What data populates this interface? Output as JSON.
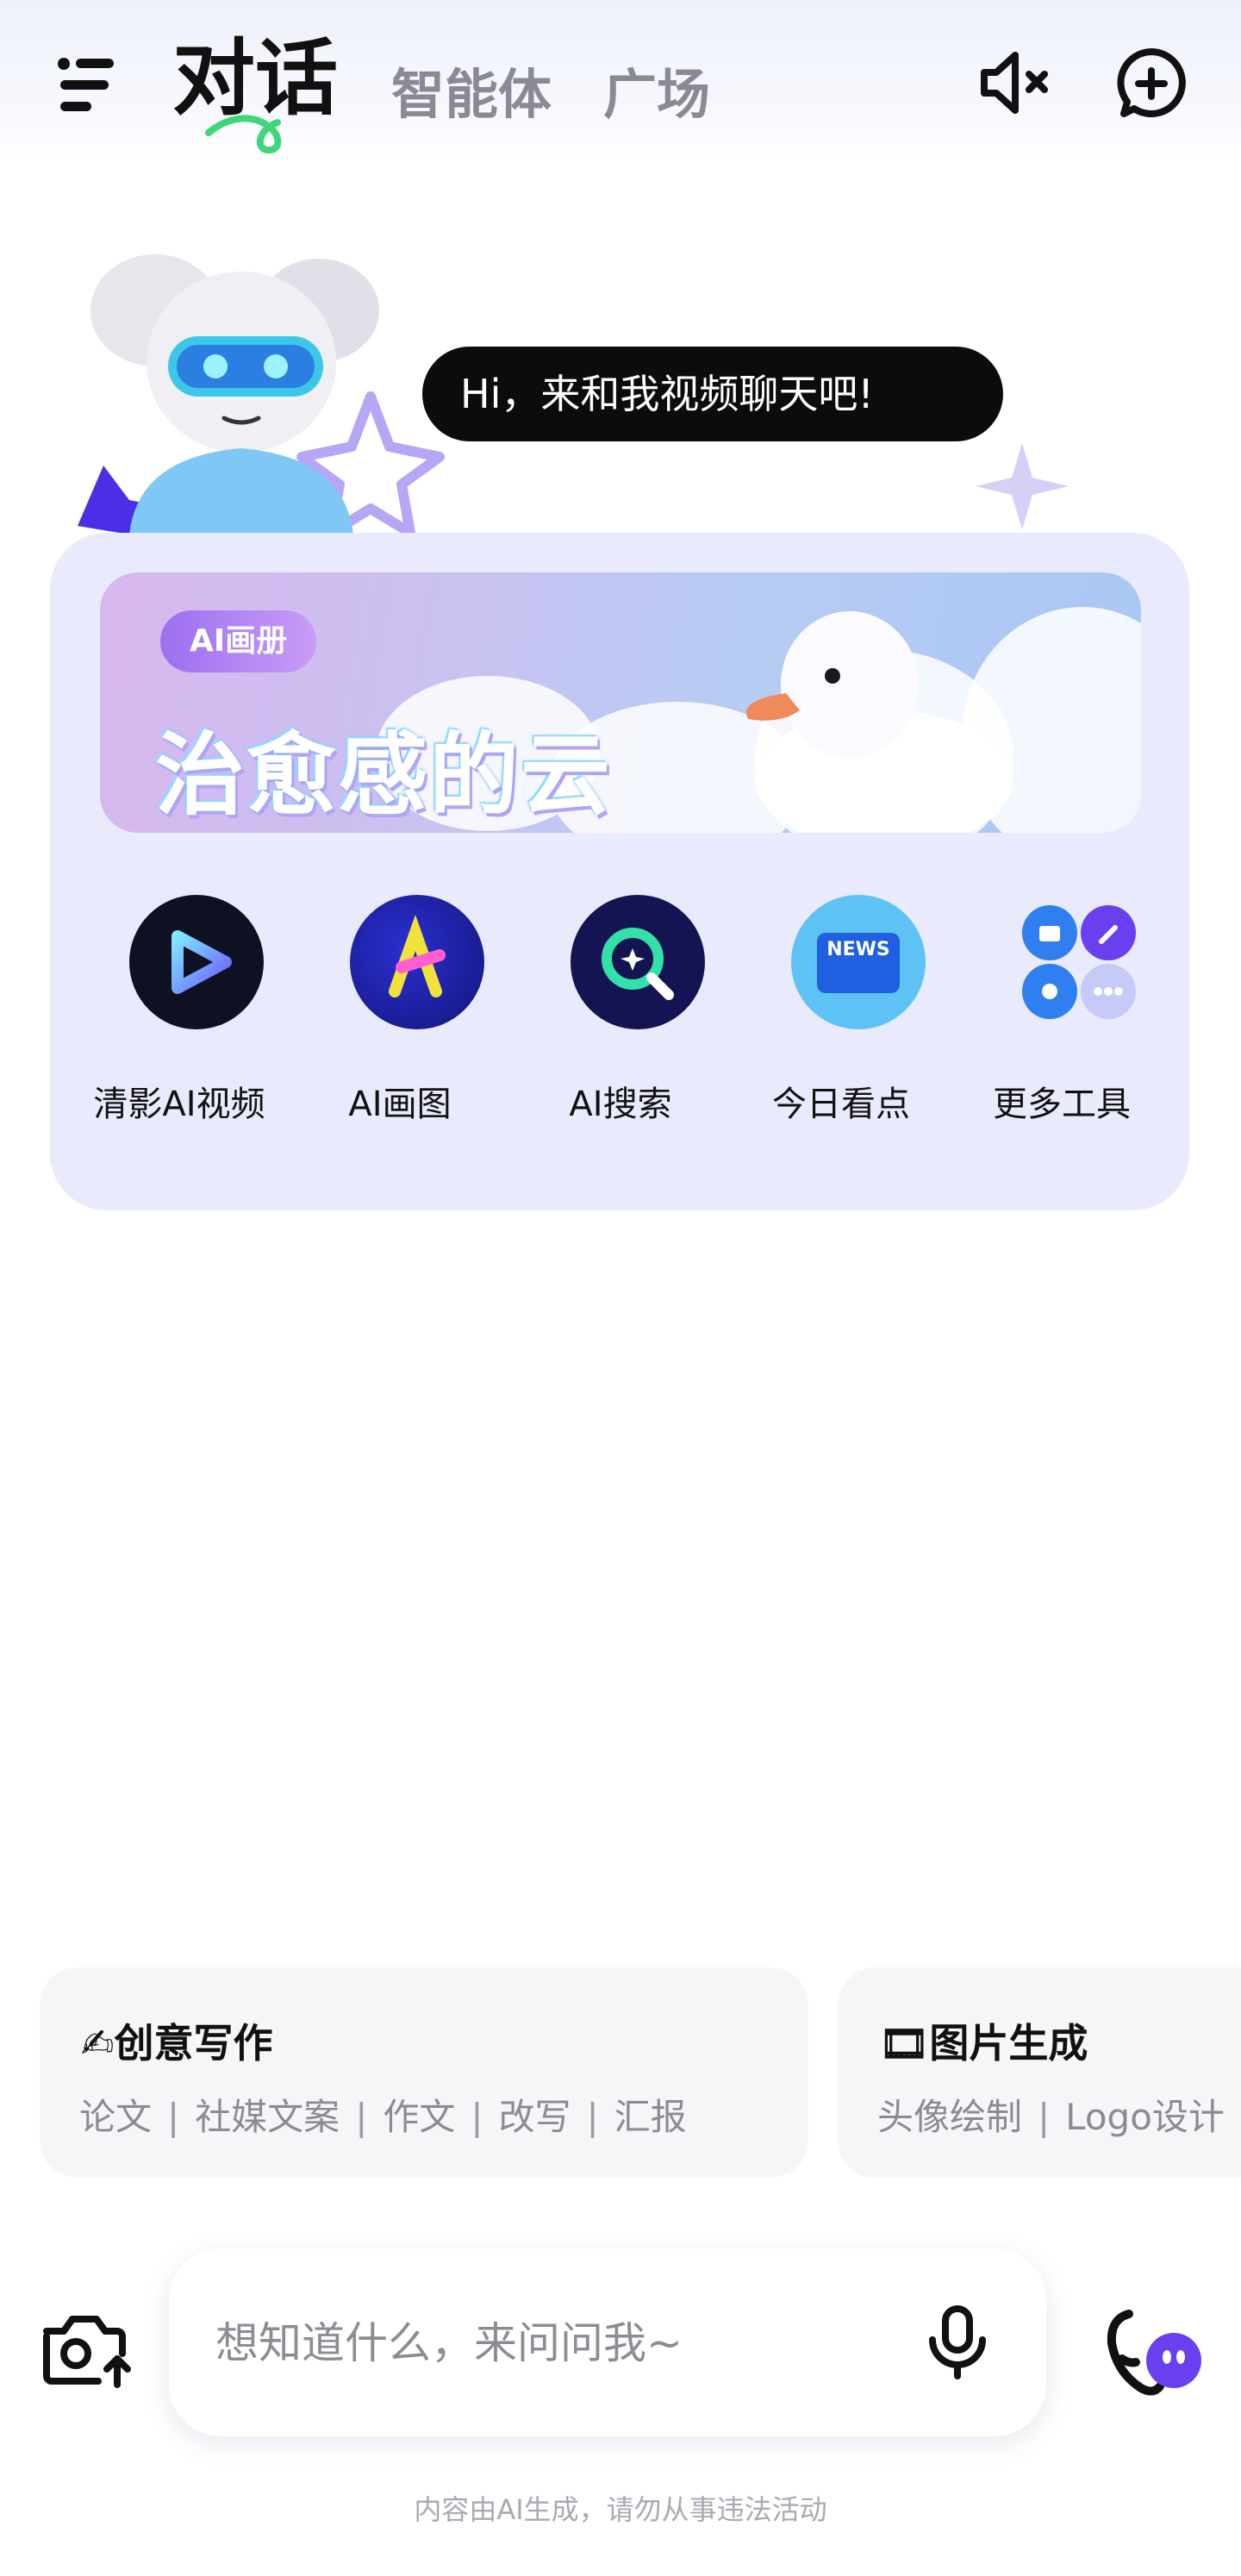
{
  "header": {
    "tabs": [
      {
        "label": "对话",
        "active": true
      },
      {
        "label": "智能体",
        "active": false
      },
      {
        "label": "广场",
        "active": false
      }
    ],
    "icons": {
      "menu": "menu-icon",
      "mute": "speaker-muted-icon",
      "new_chat": "new-chat-icon"
    }
  },
  "greeting": {
    "text": "Hi，来和我视频聊天吧!"
  },
  "banner": {
    "tag": "AI画册",
    "title": "治愈感的云"
  },
  "tools": [
    {
      "label": "清影AI视频",
      "icon": "video-play-icon"
    },
    {
      "label": "AI画图",
      "icon": "ai-draw-icon"
    },
    {
      "label": "AI搜索",
      "icon": "ai-search-icon"
    },
    {
      "label": "今日看点",
      "icon": "news-icon",
      "icon_text": "NEWS"
    },
    {
      "label": "更多工具",
      "icon": "more-tools-icon"
    }
  ],
  "suggestions": [
    {
      "title": "✍创意写作",
      "items": [
        "论文",
        "社媒文案",
        "作文",
        "改写",
        "汇报"
      ]
    },
    {
      "title": "🎞图片生成",
      "items": [
        "头像绘制",
        "Logo设计"
      ]
    }
  ],
  "input": {
    "placeholder": "想知道什么，来问问我~"
  },
  "footer": {
    "note": "内容由AI生成，请勿从事违法活动"
  },
  "colors": {
    "accent": "#6b4cf6",
    "card_bg": "#e9ebfc",
    "tab_underline": "#3fd67a"
  }
}
